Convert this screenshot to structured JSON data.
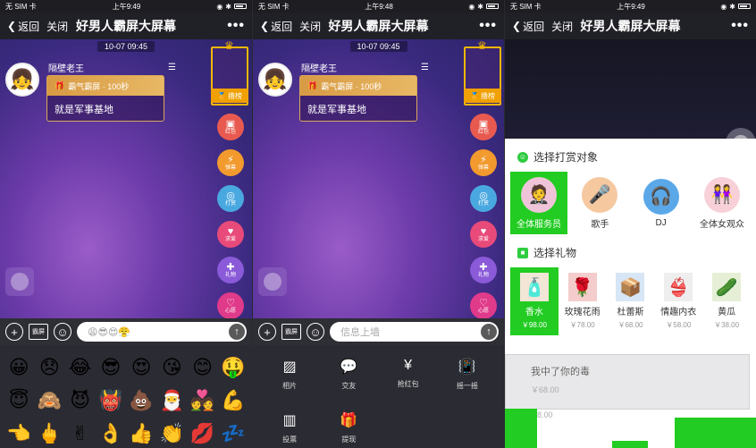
{
  "screens": [
    {
      "status": {
        "carrier": "无 SIM 卡",
        "time": "上午9:49"
      },
      "nav": {
        "back": "返回",
        "close": "关闭",
        "title": "好男人霸屏大屏幕",
        "more": "•••"
      },
      "date": "10-07 09:45",
      "username": "隔壁老王",
      "gift_line": "霸气霸屏 · 100秒",
      "message": "就是军事基地",
      "rank_label": "撸榜",
      "side_buttons": [
        "红包",
        "弹幕",
        "打赏",
        "求爱",
        "礼物",
        "心愿"
      ],
      "input_emojis": "😩😎😍😤",
      "barrage_label": "霸屏"
    },
    {
      "status": {
        "carrier": "无 SIM 卡",
        "time": "上午9:48"
      },
      "nav": {
        "back": "返回",
        "close": "关闭",
        "title": "好男人霸屏大屏幕",
        "more": "•••"
      },
      "date": "10-07 09:45",
      "username": "隔壁老王",
      "gift_line": "霸气霸屏 · 100秒",
      "message": "就是军事基地",
      "rank_label": "撸榜",
      "side_buttons": [
        "红包",
        "弹幕",
        "打赏",
        "求爱",
        "礼物",
        "心愿"
      ],
      "input_placeholder": "信息上墙",
      "barrage_label": "霸屏",
      "functions": [
        "相片",
        "交友",
        "抢红包",
        "摇一摇",
        "投票",
        "提现"
      ]
    },
    {
      "status": {
        "carrier": "无 SIM 卡",
        "time": "上午9:49"
      },
      "nav": {
        "back": "返回",
        "close": "关闭",
        "title": "好男人霸屏大屏幕",
        "more": "•••"
      },
      "target_title": "选择打赏对象",
      "targets": [
        "全体服务员",
        "歌手",
        "DJ",
        "全体女观众"
      ],
      "gift_title": "选择礼物",
      "gifts": [
        {
          "name": "香水",
          "price": "￥98.00"
        },
        {
          "name": "玫瑰花雨",
          "price": "￥78.00"
        },
        {
          "name": "杜蕾斯",
          "price": "￥68.00"
        },
        {
          "name": "情趣内衣",
          "price": "￥58.00"
        },
        {
          "name": "黄瓜",
          "price": "￥38.00"
        }
      ],
      "overlay_text": "我中了你的毒",
      "overlay_price1": "￥68.00",
      "overlay_price2": "8.00"
    }
  ],
  "emojis": [
    "😀",
    "😞",
    "😂",
    "😎",
    "😍",
    "😘",
    "😊",
    "🤑",
    "😇",
    "🙈",
    "😈",
    "👹",
    "💩",
    "🎅",
    "💑",
    "💪",
    "👈",
    "🖕",
    "✌",
    "👌",
    "👍",
    "👏",
    "💋",
    "💤"
  ],
  "colors": {
    "nav_bg": "#202027",
    "stage_purple": "#6a3aa8",
    "gold": "#f5b700",
    "selected_green": "#22cc22",
    "side_button_colors": [
      "#e85a50",
      "#f29a2e",
      "#4aa8e0",
      "#e84a7a",
      "#8a5ad8",
      "#e03a8a"
    ]
  }
}
